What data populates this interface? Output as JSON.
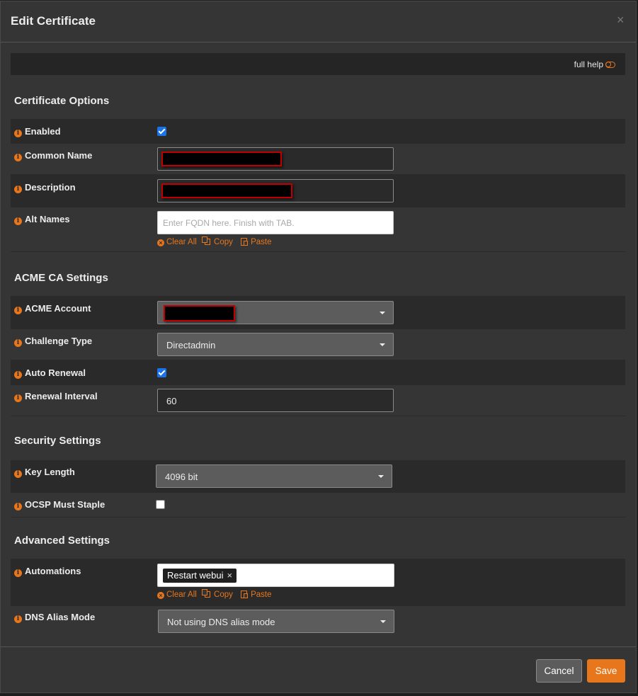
{
  "dialog": {
    "title": "Edit Certificate",
    "close_glyph": "×",
    "full_help_label": "full help"
  },
  "sections": {
    "certificate_options": "Certificate Options",
    "acme_ca_settings": "ACME CA Settings",
    "security_settings": "Security Settings",
    "advanced_settings": "Advanced Settings"
  },
  "info_glyph": "i",
  "fields": {
    "enabled": {
      "label": "Enabled",
      "checked": true
    },
    "common_name": {
      "label": "Common Name",
      "value": "[redacted]"
    },
    "description": {
      "label": "Description",
      "value": "[redacted]"
    },
    "alt_names": {
      "label": "Alt Names",
      "placeholder": "Enter FQDN here. Finish with TAB."
    },
    "acme_account": {
      "label": "ACME Account",
      "value": "[redacted]"
    },
    "challenge_type": {
      "label": "Challenge Type",
      "value": "Directadmin"
    },
    "auto_renewal": {
      "label": "Auto Renewal",
      "checked": true
    },
    "renewal_interval": {
      "label": "Renewal Interval",
      "value": "60"
    },
    "key_length": {
      "label": "Key Length",
      "value": "4096 bit"
    },
    "ocsp_must_staple": {
      "label": "OCSP Must Staple",
      "checked": false
    },
    "automations": {
      "label": "Automations",
      "tags": [
        "Restart webui"
      ],
      "tag_remove_glyph": "×"
    },
    "dns_alias_mode": {
      "label": "DNS Alias Mode",
      "value": "Not using DNS alias mode"
    }
  },
  "tag_actions": {
    "clear_all": "Clear All",
    "copy": "Copy",
    "paste": "Paste",
    "clear_icon_glyph": "×"
  },
  "footer": {
    "cancel_label": "Cancel",
    "save_label": "Save"
  },
  "icons": {
    "info": "info-circle-icon",
    "toggle": "toggle-off-icon",
    "close": "close-icon",
    "clear": "times-circle-icon",
    "copy": "copy-icon",
    "paste": "paste-icon",
    "caret": "caret-down-icon"
  },
  "colors": {
    "accent": "#e8761b",
    "checkbox": "#1a73e8",
    "background": "#353535",
    "row_dark": "#2a2a2a",
    "redaction_border": "#c00000"
  }
}
